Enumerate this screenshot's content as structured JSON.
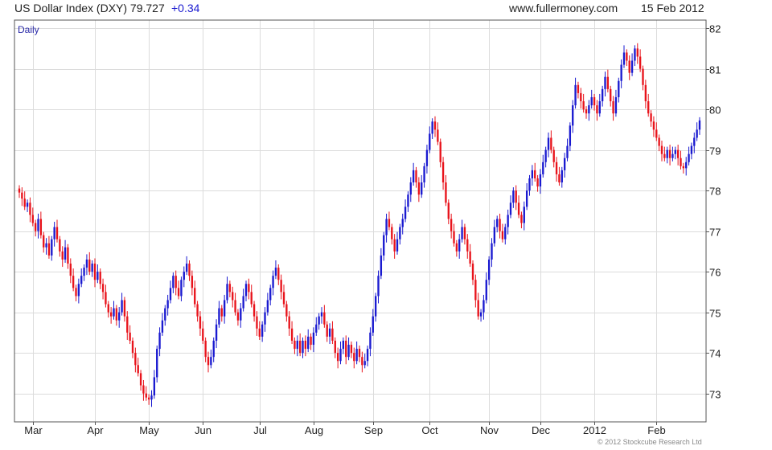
{
  "header": {
    "title": "US Dollar Index (DXY) 79.727",
    "change": "+0.34",
    "website": "www.fullermoney.com",
    "date": "15 Feb 2012"
  },
  "copyright": "© 2012 Stockcube Research Ltd",
  "colors": {
    "up": "#1a1ad0",
    "down": "#e8131b",
    "grid": "#dcdcdc",
    "frame": "#555555",
    "period_label": "#2a2aa8"
  },
  "chart_data": {
    "type": "candlestick",
    "period_label": "Daily",
    "ylim": [
      72.3,
      82.2
    ],
    "y_ticks": [
      73,
      74,
      75,
      76,
      77,
      78,
      79,
      80,
      81,
      82
    ],
    "x_tick_labels": [
      "Mar",
      "Apr",
      "May",
      "Jun",
      "Jul",
      "Aug",
      "Sep",
      "Oct",
      "Nov",
      "Dec",
      "2012",
      "Feb"
    ],
    "month_start_index": [
      5,
      28,
      48,
      68,
      89,
      109,
      131,
      152,
      174,
      193,
      213,
      236
    ],
    "grid": true,
    "closes": [
      77.95,
      77.8,
      77.6,
      77.7,
      77.4,
      77.2,
      77.0,
      77.3,
      76.9,
      76.6,
      76.7,
      76.4,
      76.8,
      77.1,
      76.8,
      76.5,
      76.3,
      76.6,
      76.2,
      75.9,
      75.6,
      75.4,
      75.7,
      75.9,
      76.1,
      76.3,
      76.0,
      76.2,
      75.8,
      76.0,
      75.7,
      75.5,
      75.2,
      75.0,
      74.9,
      75.1,
      74.8,
      75.0,
      75.3,
      74.9,
      74.5,
      74.3,
      74.0,
      73.7,
      73.5,
      73.2,
      73.0,
      72.9,
      72.85,
      72.95,
      73.4,
      74.1,
      74.5,
      74.8,
      75.1,
      75.3,
      75.6,
      75.9,
      75.6,
      75.4,
      75.8,
      76.0,
      76.2,
      75.9,
      75.6,
      75.2,
      74.9,
      74.6,
      74.3,
      73.9,
      73.7,
      73.9,
      74.3,
      74.7,
      75.1,
      74.9,
      75.3,
      75.7,
      75.5,
      75.3,
      75.0,
      74.8,
      75.1,
      75.4,
      75.7,
      75.5,
      75.2,
      74.9,
      74.6,
      74.4,
      74.7,
      75.0,
      75.3,
      75.6,
      75.9,
      76.1,
      75.8,
      75.5,
      75.2,
      74.9,
      74.6,
      74.3,
      74.1,
      74.3,
      74.0,
      74.3,
      74.1,
      74.4,
      74.2,
      74.5,
      74.7,
      74.9,
      75.0,
      74.7,
      74.4,
      74.6,
      74.3,
      74.0,
      73.8,
      74.1,
      74.3,
      73.9,
      74.2,
      74.0,
      73.8,
      74.1,
      73.9,
      73.7,
      73.8,
      74.1,
      74.5,
      74.9,
      75.4,
      75.9,
      76.4,
      76.9,
      77.3,
      77.1,
      76.8,
      76.5,
      76.8,
      77.1,
      77.3,
      77.6,
      77.9,
      78.2,
      78.5,
      78.2,
      77.9,
      78.2,
      78.6,
      79.0,
      79.4,
      79.7,
      79.5,
      79.2,
      78.7,
      78.2,
      77.7,
      77.3,
      77.0,
      76.7,
      76.5,
      76.8,
      77.1,
      76.8,
      76.5,
      76.2,
      75.8,
      75.3,
      74.9,
      75.0,
      75.3,
      75.8,
      76.3,
      76.7,
      77.1,
      77.3,
      77.0,
      76.8,
      77.1,
      77.4,
      77.7,
      78.0,
      77.7,
      77.4,
      77.2,
      77.6,
      78.0,
      78.3,
      78.5,
      78.3,
      78.1,
      78.4,
      78.7,
      79.0,
      79.3,
      79.0,
      78.7,
      78.4,
      78.2,
      78.5,
      78.8,
      79.1,
      79.6,
      80.1,
      80.6,
      80.4,
      80.2,
      80.0,
      79.9,
      80.1,
      80.3,
      80.1,
      79.9,
      80.2,
      80.5,
      80.8,
      80.5,
      80.2,
      79.9,
      80.3,
      80.7,
      81.1,
      81.4,
      81.2,
      80.9,
      81.2,
      81.5,
      81.3,
      81.0,
      80.6,
      80.2,
      79.9,
      79.7,
      79.5,
      79.3,
      79.1,
      78.9,
      78.8,
      79.0,
      78.8,
      78.9,
      79.0,
      78.8,
      78.6,
      78.55,
      78.7,
      78.9,
      79.1,
      79.3,
      79.5,
      79.727
    ]
  }
}
